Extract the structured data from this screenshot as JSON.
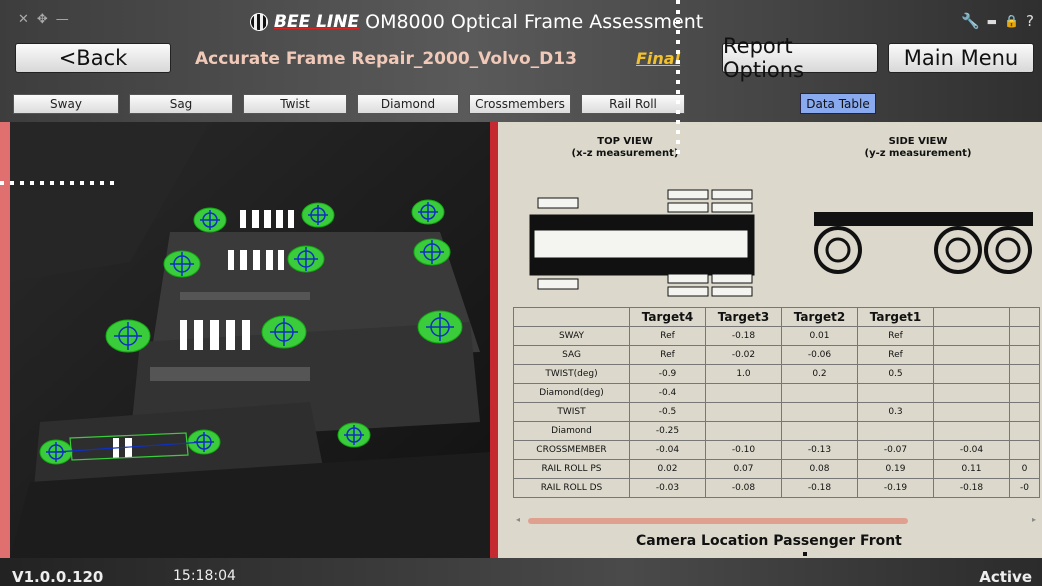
{
  "header": {
    "brand_logo": "BEE LINE",
    "app_title": "OM8000 Optical Frame Assessment",
    "back_label": "<Back",
    "job_title": "Accurate Frame Repair_2000_Volvo_D13",
    "final_label": "Final",
    "report_options_label": "Report Options",
    "main_menu_label": "Main Menu"
  },
  "tabs": [
    "Sway",
    "Sag",
    "Twist",
    "Diamond",
    "Crossmembers",
    "Rail Roll"
  ],
  "data_table_label": "Data Table",
  "views": {
    "top_title": "TOP VIEW",
    "top_sub": "(x-z measurement)",
    "side_title": "SIDE VIEW",
    "side_sub": "(y-z measurement)"
  },
  "table": {
    "headers": [
      "",
      "Target4",
      "Target3",
      "Target2",
      "Target1",
      "",
      ""
    ],
    "rows": [
      [
        "SWAY",
        "Ref",
        "-0.18",
        "0.01",
        "Ref",
        "",
        ""
      ],
      [
        "SAG",
        "Ref",
        "-0.02",
        "-0.06",
        "Ref",
        "",
        ""
      ],
      [
        "TWIST(deg)",
        "-0.9",
        "1.0",
        "0.2",
        "0.5",
        "",
        ""
      ],
      [
        "Diamond(deg)",
        "-0.4",
        "",
        "",
        "",
        "",
        ""
      ],
      [
        "TWIST",
        "-0.5",
        "",
        "",
        "0.3",
        "",
        ""
      ],
      [
        "Diamond",
        "-0.25",
        "",
        "",
        "",
        "",
        ""
      ],
      [
        "CROSSMEMBER",
        "-0.04",
        "-0.10",
        "-0.13",
        "-0.07",
        "-0.04",
        ""
      ],
      [
        "RAIL ROLL PS",
        "0.02",
        "0.07",
        "0.08",
        "0.19",
        "0.11",
        "0"
      ],
      [
        "RAIL ROLL DS",
        "-0.03",
        "-0.08",
        "-0.18",
        "-0.19",
        "-0.18",
        "-0"
      ]
    ]
  },
  "camera_location": "Camera Location Passenger Front",
  "status": {
    "version": "V1.0.0.120",
    "time": "15:18:04",
    "state": "Active"
  },
  "colors": {
    "accent_red": "#c52a30",
    "target_green": "#33cc33",
    "data_table_btn": "#8aaaf0",
    "final_gold": "#f0c030"
  }
}
